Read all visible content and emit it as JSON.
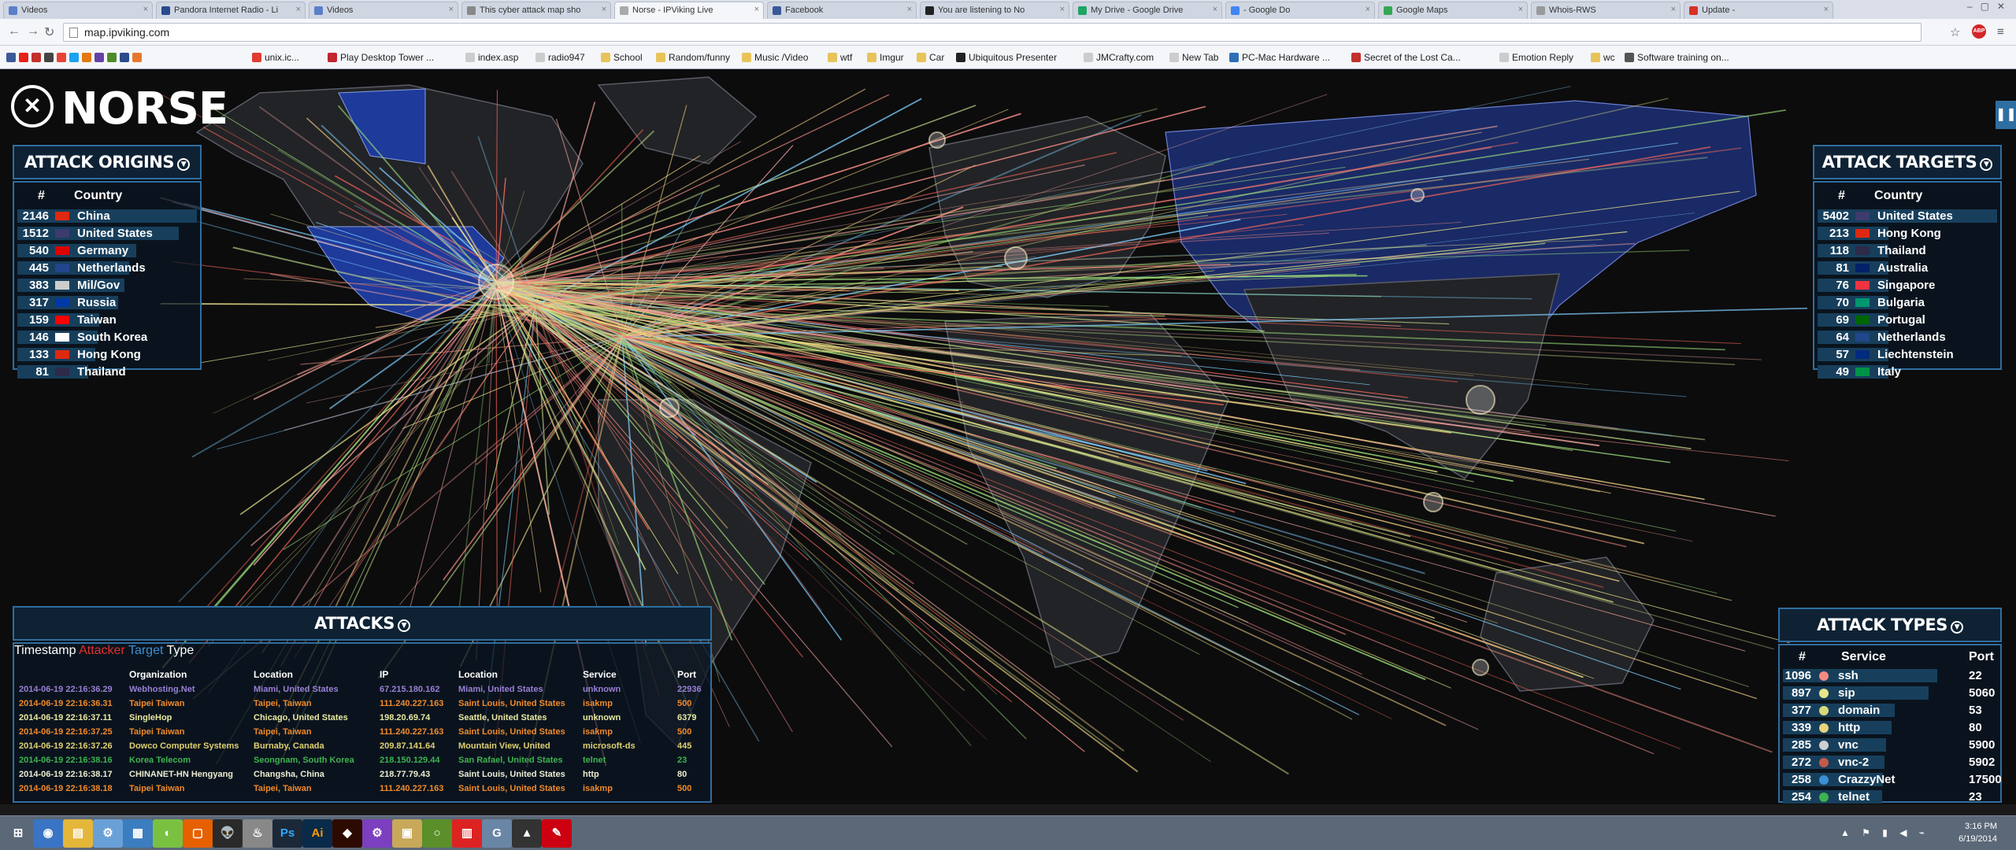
{
  "browser": {
    "tabs": [
      {
        "label": "Videos",
        "color": "#5b7fc8",
        "active": false
      },
      {
        "label": "Pandora Internet Radio - Li",
        "color": "#2a4b8d",
        "active": false
      },
      {
        "label": "Videos",
        "color": "#5b7fc8",
        "active": false
      },
      {
        "label": "This cyber attack map sho",
        "color": "#888888",
        "active": false
      },
      {
        "label": "Norse - IPViking Live",
        "color": "#aaaaaa",
        "active": true
      },
      {
        "label": "Facebook",
        "color": "#3b5998",
        "active": false
      },
      {
        "label": "You are listening to No",
        "color": "#222222",
        "active": false
      },
      {
        "label": "My Drive - Google Drive",
        "color": "#1fa463",
        "active": false
      },
      {
        "label": "- Google Do",
        "color": "#4285f4",
        "active": false
      },
      {
        "label": "Google Maps",
        "color": "#34a853",
        "active": false
      },
      {
        "label": "Whois-RWS",
        "color": "#999999",
        "active": false
      },
      {
        "label": "Update -",
        "color": "#d93025",
        "active": false
      }
    ],
    "url": "map.ipviking.com",
    "adblock": "ABP",
    "bookmarks": [
      {
        "label": "unix.ic...",
        "color": "#e03c31"
      },
      {
        "label": "Play Desktop Tower ...",
        "color": "#c2262e"
      },
      {
        "label": "index.asp",
        "color": "#cccccc"
      },
      {
        "label": "radio947",
        "color": "#cccccc"
      },
      {
        "label": "School",
        "color": "#e8c35a"
      },
      {
        "label": "Random/funny",
        "color": "#e8c35a"
      },
      {
        "label": "Music /Video",
        "color": "#e8c35a"
      },
      {
        "label": "wtf",
        "color": "#e8c35a"
      },
      {
        "label": "Imgur",
        "color": "#e8c35a"
      },
      {
        "label": "Car",
        "color": "#e8c35a"
      },
      {
        "label": "Ubiquitous Presenter",
        "color": "#222222"
      },
      {
        "label": "JMCrafty.com",
        "color": "#cccccc"
      },
      {
        "label": "New Tab",
        "color": "#cccccc"
      },
      {
        "label": "PC-Mac Hardware ...",
        "color": "#2c6fb5"
      },
      {
        "label": "Secret of the Lost Ca...",
        "color": "#c4302b"
      },
      {
        "label": "Emotion Reply",
        "color": "#cccccc"
      },
      {
        "label": "wc",
        "color": "#e8c35a"
      },
      {
        "label": "Software training on...",
        "color": "#555555"
      }
    ]
  },
  "logo": {
    "mark": "✕",
    "word": "NORSE"
  },
  "origins": {
    "title": "ATTACK ORIGINS",
    "col_num": "#",
    "col_country": "Country",
    "max": 2146,
    "rows": [
      {
        "count": "2146",
        "country": "China",
        "value": 2146,
        "flag": "#de2910"
      },
      {
        "count": "1512",
        "country": "United States",
        "value": 1512,
        "flag": "#3c3b6e"
      },
      {
        "count": "540",
        "country": "Germany",
        "value": 540,
        "flag": "#dd0000"
      },
      {
        "count": "445",
        "country": "Netherlands",
        "value": 445,
        "flag": "#21468b"
      },
      {
        "count": "383",
        "country": "Mil/Gov",
        "value": 383,
        "flag": "#cccccc"
      },
      {
        "count": "317",
        "country": "Russia",
        "value": 317,
        "flag": "#0039a6"
      },
      {
        "count": "159",
        "country": "Taiwan",
        "value": 159,
        "flag": "#fe0000"
      },
      {
        "count": "146",
        "country": "South Korea",
        "value": 146,
        "flag": "#ffffff"
      },
      {
        "count": "133",
        "country": "Hong Kong",
        "value": 133,
        "flag": "#de2910"
      },
      {
        "count": "81",
        "country": "Thailand",
        "value": 81,
        "flag": "#2d2a4a"
      }
    ]
  },
  "targets": {
    "title": "ATTACK TARGETS",
    "col_num": "#",
    "col_country": "Country",
    "max": 5402,
    "rows": [
      {
        "count": "5402",
        "country": "United States",
        "value": 5402,
        "flag": "#3c3b6e"
      },
      {
        "count": "213",
        "country": "Hong Kong",
        "value": 213,
        "flag": "#de2910"
      },
      {
        "count": "118",
        "country": "Thailand",
        "value": 118,
        "flag": "#2d2a4a"
      },
      {
        "count": "81",
        "country": "Australia",
        "value": 81,
        "flag": "#012169"
      },
      {
        "count": "76",
        "country": "Singapore",
        "value": 76,
        "flag": "#ef3340"
      },
      {
        "count": "70",
        "country": "Bulgaria",
        "value": 70,
        "flag": "#00966e"
      },
      {
        "count": "69",
        "country": "Portugal",
        "value": 69,
        "flag": "#006600"
      },
      {
        "count": "64",
        "country": "Netherlands",
        "value": 64,
        "flag": "#21468b"
      },
      {
        "count": "57",
        "country": "Liechtenstein",
        "value": 57,
        "flag": "#002b7f"
      },
      {
        "count": "49",
        "country": "Italy",
        "value": 49,
        "flag": "#009246"
      }
    ]
  },
  "types": {
    "title": "ATTACK TYPES",
    "col_num": "#",
    "col_service": "Service",
    "col_port": "Port",
    "max": 1096,
    "rows": [
      {
        "count": "1096",
        "service": "ssh",
        "port": "22",
        "value": 1096,
        "color": "#f28b82"
      },
      {
        "count": "897",
        "service": "sip",
        "port": "5060",
        "value": 897,
        "color": "#e8e48a"
      },
      {
        "count": "377",
        "service": "domain",
        "port": "53",
        "value": 377,
        "color": "#d8d87a"
      },
      {
        "count": "339",
        "service": "http",
        "port": "80",
        "value": 339,
        "color": "#e8d47a"
      },
      {
        "count": "285",
        "service": "vnc",
        "port": "5900",
        "value": 285,
        "color": "#cfcfcf"
      },
      {
        "count": "272",
        "service": "vnc-2",
        "port": "5902",
        "value": 272,
        "color": "#c45a4a"
      },
      {
        "count": "258",
        "service": "CrazzyNet",
        "port": "17500",
        "value": 258,
        "color": "#3b8fd6"
      },
      {
        "count": "254",
        "service": "telnet",
        "port": "23",
        "value": 254,
        "color": "#3fb34f"
      }
    ]
  },
  "attacks": {
    "title": "ATTACKS",
    "h_timestamp": "Timestamp",
    "h_attacker": "Attacker",
    "h_target": "Target",
    "h_type": "Type",
    "s_org": "Organization",
    "s_loc": "Location",
    "s_ip": "IP",
    "s_tloc": "Location",
    "s_service": "Service",
    "s_port": "Port",
    "attacker_color": "#e03030",
    "target_color": "#3b8fd6",
    "rows": [
      {
        "ts": "2014-06-19  22:16:36.29",
        "org": "Webhosting.Net",
        "loc": "Miami, United States",
        "ip": "67.215.180.162",
        "tloc": "Miami, United States",
        "service": "unknown",
        "port": "22936",
        "color": "#9a7fd6"
      },
      {
        "ts": "2014-06-19  22:16:36.31",
        "org": "Taipei Taiwan",
        "loc": "Taipei, Taiwan",
        "ip": "111.240.227.163",
        "tloc": "Saint Louis, United States",
        "service": "isakmp",
        "port": "500",
        "color": "#f08a2a"
      },
      {
        "ts": "2014-06-19  22:16:37.11",
        "org": "SingleHop",
        "loc": "Chicago, United States",
        "ip": "198.20.69.74",
        "tloc": "Seattle, United States",
        "service": "unknown",
        "port": "6379",
        "color": "#e8e8a0"
      },
      {
        "ts": "2014-06-19  22:16:37.25",
        "org": "Taipei Taiwan",
        "loc": "Taipei, Taiwan",
        "ip": "111.240.227.163",
        "tloc": "Saint Louis, United States",
        "service": "isakmp",
        "port": "500",
        "color": "#f08a2a"
      },
      {
        "ts": "2014-06-19  22:16:37.26",
        "org": "Dowco Computer Systems",
        "loc": "Burnaby, Canada",
        "ip": "209.87.141.64",
        "tloc": "Mountain View, United",
        "service": "microsoft-ds",
        "port": "445",
        "color": "#e0d070"
      },
      {
        "ts": "2014-06-19  22:16:38.16",
        "org": "Korea Telecom",
        "loc": "Seongnam, South Korea",
        "ip": "218.150.129.44",
        "tloc": "San Rafael, United States",
        "service": "telnet",
        "port": "23",
        "color": "#3fb34f"
      },
      {
        "ts": "2014-06-19  22:16:38.17",
        "org": "CHINANET-HN Hengyang",
        "loc": "Changsha, China",
        "ip": "218.77.79.43",
        "tloc": "Saint Louis, United States",
        "service": "http",
        "port": "80",
        "color": "#ececd0"
      },
      {
        "ts": "2014-06-19  22:16:38.18",
        "org": "Taipei Taiwan",
        "loc": "Taipei, Taiwan",
        "ip": "111.240.227.163",
        "tloc": "Saint Louis, United States",
        "service": "isakmp",
        "port": "500",
        "color": "#f08a2a"
      }
    ]
  },
  "taskbar": {
    "apps": [
      "⊞",
      "◉",
      "▤",
      "⚙",
      "▦",
      "◐",
      "▢",
      "👽",
      "♨",
      "Ps",
      "Ai",
      "◆",
      "⚙",
      "▣",
      "○",
      "▥",
      "G",
      "▲",
      "✎"
    ],
    "time": "3:16 PM",
    "date": "6/19/2014"
  }
}
